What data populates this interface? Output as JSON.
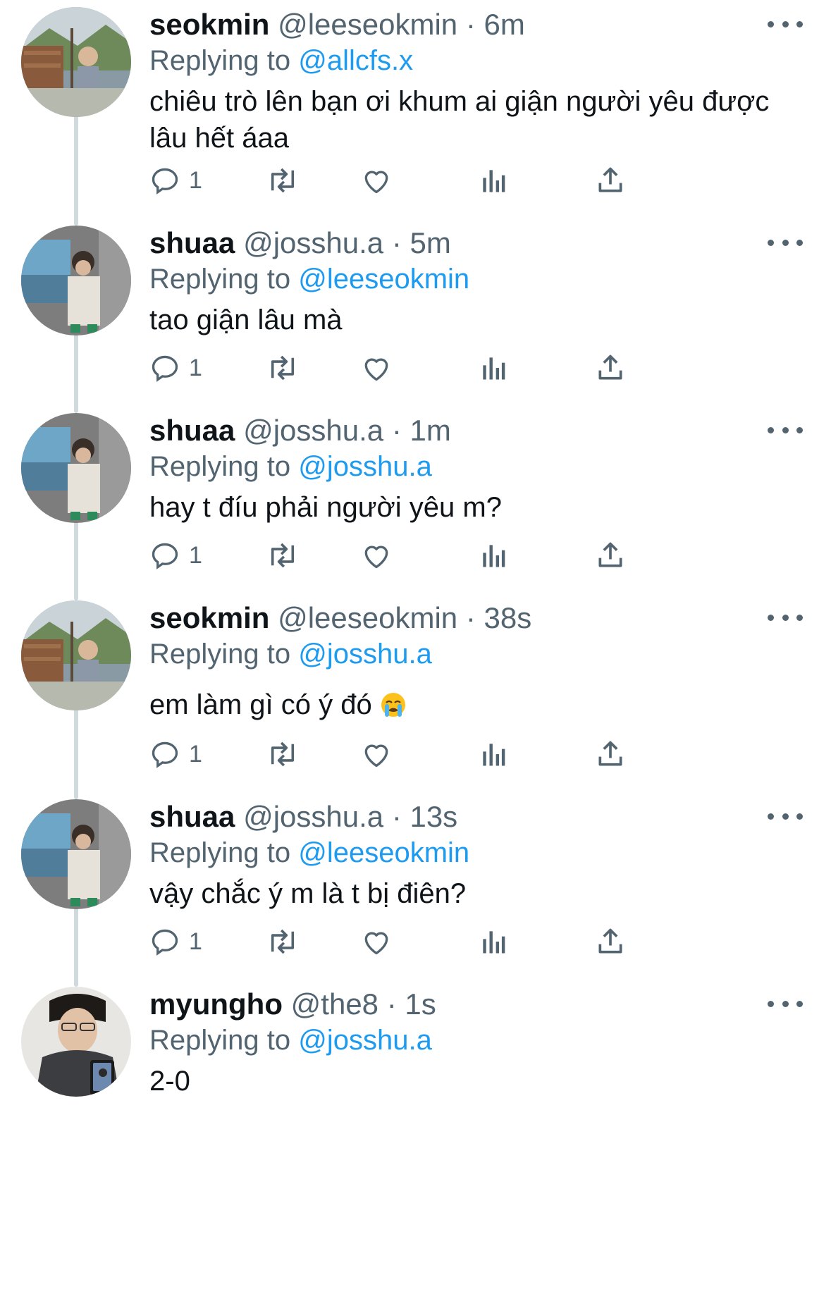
{
  "tweets": [
    {
      "name": "seokmin",
      "handle": "@leeseokmin",
      "time": "· 6m",
      "reply_prefix": "Replying to ",
      "reply_to": "@allcfs.x",
      "text": "chiêu trò lên bạn ơi khum ai giận người yêu được lâu hết áaa",
      "reply_count": "1",
      "avatar": "seokmin-avatar"
    },
    {
      "name": "shuaa",
      "handle": "@josshu.a",
      "time": "· 5m",
      "reply_prefix": "Replying to ",
      "reply_to": "@leeseokmin",
      "text": "tao giận lâu mà",
      "reply_count": "1",
      "avatar": "shuaa-avatar"
    },
    {
      "name": "shuaa",
      "handle": "@josshu.a",
      "time": "· 1m",
      "reply_prefix": "Replying to ",
      "reply_to": "@josshu.a",
      "text": "hay t đíu phải người yêu m?",
      "reply_count": "1",
      "avatar": "shuaa-avatar"
    },
    {
      "name": "seokmin",
      "handle": "@leeseokmin",
      "time": "· 38s",
      "reply_prefix": "Replying to ",
      "reply_to": "@josshu.a",
      "text": "em làm gì có ý đó",
      "emoji": "loudly-crying-face",
      "reply_count": "1",
      "avatar": "seokmin-avatar"
    },
    {
      "name": "shuaa",
      "handle": "@josshu.a",
      "time": "· 13s",
      "reply_prefix": "Replying to ",
      "reply_to": "@leeseokmin",
      "text": "vậy chắc ý m là t bị điên?",
      "reply_count": "1",
      "avatar": "shuaa-avatar"
    },
    {
      "name": "myungho",
      "handle": "@the8",
      "time": "· 1s",
      "reply_prefix": "Replying to ",
      "reply_to": "@josshu.a",
      "text": "2-0",
      "avatar": "myungho-avatar"
    }
  ],
  "colors": {
    "text": "#0f1419",
    "secondary": "#536471",
    "link": "#1d9bf0",
    "thread_line": "#cfd9de"
  },
  "icons": [
    "reply-icon",
    "retweet-icon",
    "like-icon",
    "views-icon",
    "share-icon",
    "more-icon"
  ]
}
